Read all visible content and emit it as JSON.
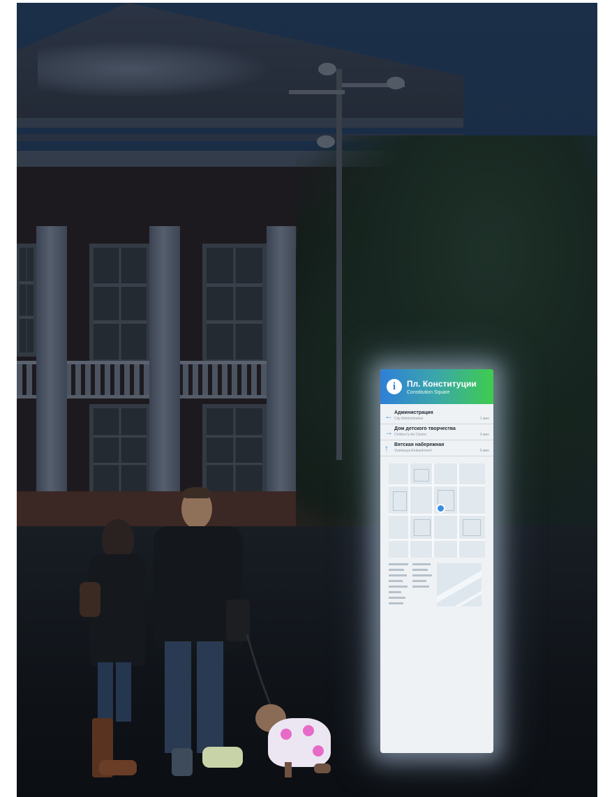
{
  "kiosk": {
    "header": {
      "title": "Пл. Конституции",
      "subtitle": "Constitution Square",
      "icon": "info-icon",
      "gradient": [
        "#2f7fd8",
        "#3fcc4e"
      ]
    },
    "destinations": [
      {
        "arrow": "←",
        "name_ru": "Администрация",
        "name_en": "City Administration",
        "time": "1 мин"
      },
      {
        "arrow": "→",
        "name_ru": "Дом детского творчества",
        "name_en": "Children's Art Centre",
        "time": "3 мин"
      },
      {
        "arrow": "↑",
        "name_ru": "Вятская набережная",
        "name_en": "Vyatskaya Embankment",
        "time": "5 мин"
      }
    ]
  }
}
